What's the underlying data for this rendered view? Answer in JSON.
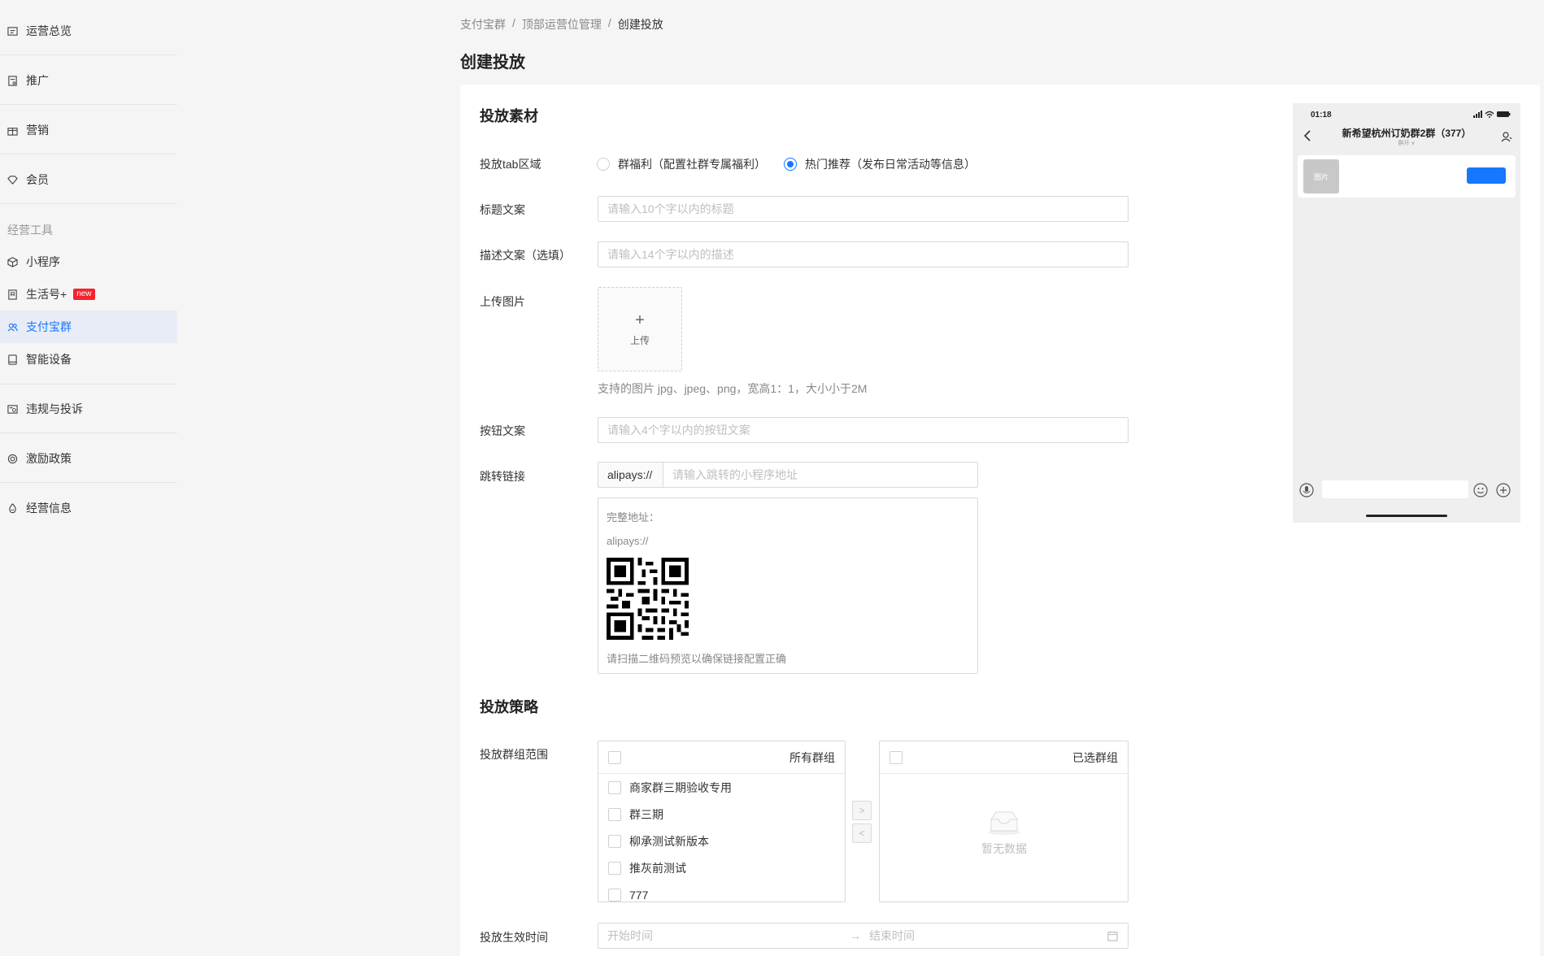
{
  "sidebar": {
    "items": [
      {
        "label": "运营总览",
        "icon": "dashboard-icon"
      },
      {
        "label": "推广",
        "icon": "promotion-icon"
      },
      {
        "label": "营销",
        "icon": "gift-icon"
      },
      {
        "label": "会员",
        "icon": "diamond-icon"
      }
    ],
    "section_label": "经营工具",
    "tools": [
      {
        "label": "小程序",
        "icon": "cube-icon"
      },
      {
        "label": "生活号+",
        "icon": "bookmark-icon",
        "badge": "new"
      },
      {
        "label": "支付宝群",
        "icon": "group-icon",
        "active": true
      },
      {
        "label": "智能设备",
        "icon": "device-icon"
      }
    ],
    "bottom": [
      {
        "label": "违规与投诉",
        "icon": "complaint-icon"
      },
      {
        "label": "激励政策",
        "icon": "target-icon"
      },
      {
        "label": "经营信息",
        "icon": "info-icon"
      }
    ]
  },
  "breadcrumb": [
    "支付宝群",
    "顶部运营位管理",
    "创建投放"
  ],
  "breadcrumb_sep": "/",
  "page_title": "创建投放",
  "material": {
    "section_title": "投放素材",
    "tab_area": {
      "label": "投放tab区域",
      "options": [
        "群福利（配置社群专属福利）",
        "热门推荐（发布日常活动等信息）"
      ],
      "selected": 1
    },
    "title_field": {
      "label": "标题文案",
      "placeholder": "请输入10个字以内的标题"
    },
    "desc_field": {
      "label": "描述文案（选填）",
      "placeholder": "请输入14个字以内的描述"
    },
    "upload": {
      "label": "上传图片",
      "plus": "+",
      "text": "上传",
      "hint": "支持的图片 jpg、jpeg、png，宽高1：1，大小小于2M"
    },
    "button_field": {
      "label": "按钮文案",
      "placeholder": "请输入4个字以内的按钮文案"
    },
    "link": {
      "label": "跳转链接",
      "prefix": "alipays://",
      "placeholder": "请输入跳转的小程序地址",
      "full_label": "完整地址：",
      "full_value": "alipays://",
      "qr_hint": "请扫描二维码预览以确保链接配置正确"
    }
  },
  "strategy": {
    "section_title": "投放策略",
    "group_scope": {
      "label": "投放群组范围",
      "left_title": "所有群组",
      "right_title": "已选群组",
      "items": [
        "商家群三期验收专用",
        "群三期",
        "柳承测试新版本",
        "推灰前测试",
        "777"
      ],
      "empty_text": "暂无数据",
      "to_right": ">",
      "to_left": "<"
    },
    "time": {
      "label": "投放生效时间",
      "start_placeholder": "开始时间",
      "end_placeholder": "结束时间",
      "arrow": "→"
    }
  },
  "phone": {
    "time": "01:18",
    "chat_title": "新希望杭州订奶群2群（377）",
    "chat_sub": "群开 ∨",
    "image_placeholder": "图片"
  },
  "colors": {
    "accent": "#1677ff",
    "badge": "#f5222d"
  }
}
